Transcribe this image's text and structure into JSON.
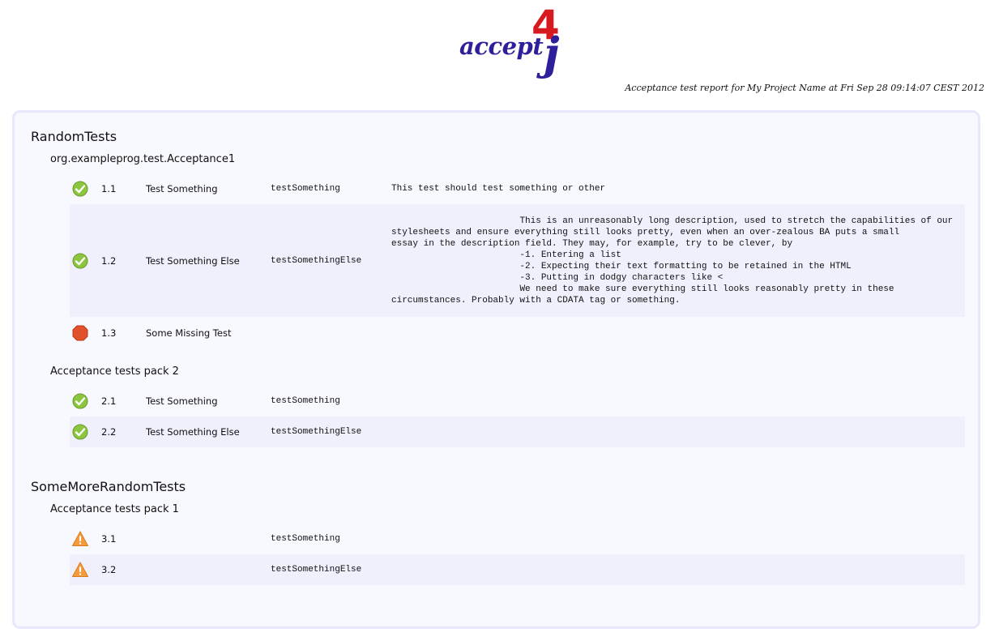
{
  "logo": {
    "text_main": "accept",
    "text_four": "4",
    "text_j": "j"
  },
  "report_line": "Acceptance test report for My Project Name at Fri Sep 28 09:14:07 CEST 2012",
  "groups": [
    {
      "title": "RandomTests",
      "packs": [
        {
          "title": "org.exampleprog.test.Acceptance1",
          "tests": [
            {
              "status": "pass-icon",
              "num": "1.1",
              "name": "Test Something",
              "method": "testSomething",
              "description": "This test should test something or other"
            },
            {
              "status": "pass-icon",
              "num": "1.2",
              "name": "Test Something Else",
              "method": "testSomethingElse",
              "description": "                \tThis is an unreasonably long description, used to stretch the capabilities of our\nstylesheets and ensure everything still looks pretty, even when an over-zealous BA puts a small\nessay in the description field. They may, for example, try to be clever, by\n                        -1. Entering a list\n                        -2. Expecting their text formatting to be retained in the HTML\n                        -3. Putting in dodgy characters like <\n                \tWe need to make sure everything still looks reasonably pretty in these\ncircumstances. Probably with a CDATA tag or something."
            },
            {
              "status": "missing-icon",
              "num": "1.3",
              "name": "Some Missing Test",
              "method": "",
              "description": ""
            }
          ]
        },
        {
          "title": "Acceptance tests pack 2",
          "tests": [
            {
              "status": "pass-icon",
              "num": "2.1",
              "name": "Test Something",
              "method": "testSomething",
              "description": ""
            },
            {
              "status": "pass-icon",
              "num": "2.2",
              "name": "Test Something Else",
              "method": "testSomethingElse",
              "description": ""
            }
          ]
        }
      ]
    },
    {
      "title": "SomeMoreRandomTests",
      "packs": [
        {
          "title": "Acceptance tests pack 1",
          "tests": [
            {
              "status": "warning-icon",
              "num": "3.1",
              "name": "",
              "method": "testSomething",
              "description": ""
            },
            {
              "status": "warning-icon",
              "num": "3.2",
              "name": "",
              "method": "testSomethingElse",
              "description": ""
            }
          ]
        }
      ]
    }
  ],
  "colors": {
    "pass": "#8cc63f",
    "missing": "#e2502a",
    "warning": "#f39c3d",
    "logo_blue": "#2e1f9a",
    "logo_red": "#d71920"
  }
}
